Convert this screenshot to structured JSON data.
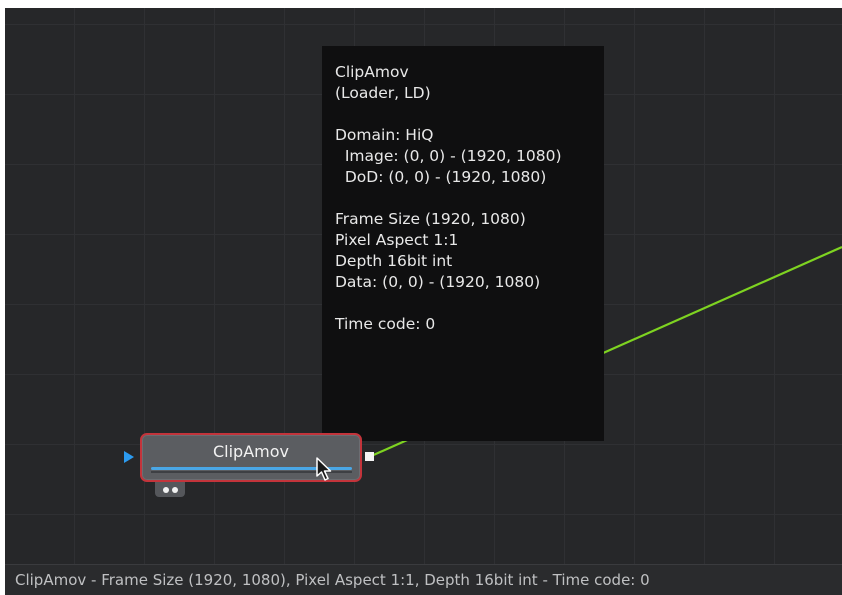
{
  "tooltip": {
    "lines": [
      "ClipAmov",
      "(Loader, LD)",
      "",
      "Domain: HiQ",
      "  Image: (0, 0) - (1920, 1080)",
      "  DoD: (0, 0) - (1920, 1080)",
      "",
      "Frame Size (1920, 1080)",
      "Pixel Aspect 1:1",
      "Depth 16bit int",
      "Data: (0, 0) - (1920, 1080)",
      "",
      "Time code: 0"
    ]
  },
  "node": {
    "label": "ClipAmov",
    "selected": true,
    "colors": {
      "selection_border": "#c3343b",
      "bar": "#4aa7e6",
      "input_port": "#2c9bf0",
      "output_port": "#f4f4f4",
      "connection": "#7ed321"
    }
  },
  "icons": {
    "input_port": "triangle-right-icon",
    "output_port": "square-icon",
    "cursor": "pointer-cursor-icon"
  },
  "statusbar": {
    "text": "ClipAmov - Frame Size (1920, 1080), Pixel Aspect 1:1, Depth 16bit int - Time code: 0"
  }
}
